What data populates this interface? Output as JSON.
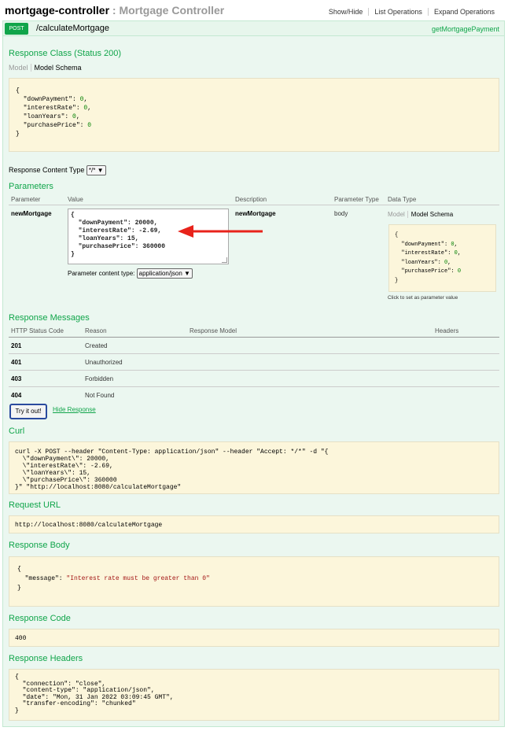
{
  "header": {
    "controller": "mortgage-controller",
    "controller_title": " : Mortgage Controller",
    "links": [
      "Show/Hide",
      "List Operations",
      "Expand Operations"
    ]
  },
  "operation": {
    "method": "POST",
    "path": "/calculateMortgage",
    "nickname": "getMortgagePayment",
    "method_color": "#10a54a"
  },
  "response_class": {
    "title": "Response Class (Status 200)",
    "tab_model": "Model",
    "tab_schema": "Model Schema",
    "schema_lines": [
      "{",
      "  \"downPayment\": 0,",
      "  \"interestRate\": 0,",
      "  \"loanYears\": 0,",
      "  \"purchasePrice\": 0",
      "}"
    ]
  },
  "response_content_type": {
    "label": "Response Content Type",
    "value": "*/*"
  },
  "parameters": {
    "title": "Parameters",
    "headers": [
      "Parameter",
      "Value",
      "Description",
      "Parameter Type",
      "Data Type"
    ],
    "row": {
      "name": "newMortgage",
      "value_lines": [
        "{",
        "  \"downPayment\": 20000,",
        "  \"interestRate\": -2.69,",
        "  \"loanYears\": 15,",
        "  \"purchasePrice\": 360000",
        "}"
      ],
      "description": "newMortgage",
      "param_type": "body",
      "content_type_label": "Parameter content type:",
      "content_type_value": "application/json",
      "data_tab_model": "Model",
      "data_tab_schema": "Model Schema",
      "schema_lines": [
        "{",
        "  \"downPayment\": 0,",
        "  \"interestRate\": 0,",
        "  \"loanYears\": 0,",
        "  \"purchasePrice\": 0",
        "}"
      ],
      "click_hint": "Click to set as parameter value"
    },
    "annotation_arrow_color": "#e8231b"
  },
  "response_messages": {
    "title": "Response Messages",
    "headers": [
      "HTTP Status Code",
      "Reason",
      "Response Model",
      "Headers"
    ],
    "rows": [
      {
        "code": "201",
        "reason": "Created"
      },
      {
        "code": "401",
        "reason": "Unauthorized"
      },
      {
        "code": "403",
        "reason": "Forbidden"
      },
      {
        "code": "404",
        "reason": "Not Found"
      }
    ]
  },
  "actions": {
    "try_label": "Try it out!",
    "hide_label": "Hide Response"
  },
  "curl": {
    "title": "Curl",
    "lines": [
      "curl -X POST --header \"Content-Type: application/json\" --header \"Accept: */*\" -d \"{",
      "  \\\"downPayment\\\": 20000,",
      "  \\\"interestRate\\\": -2.69,",
      "  \\\"loanYears\\\": 15,",
      "  \\\"purchasePrice\\\": 360000",
      "}\" \"http://localhost:8080/calculateMortgage\""
    ]
  },
  "request_url": {
    "title": "Request URL",
    "value": "http://localhost:8080/calculateMortgage"
  },
  "response_body": {
    "title": "Response Body",
    "open": "{",
    "key": "  \"message\": ",
    "message": "\"Interest rate must be greater than 0\"",
    "close": "}"
  },
  "response_code": {
    "title": "Response Code",
    "value": "400"
  },
  "response_headers": {
    "title": "Response Headers",
    "lines": [
      "{",
      "  \"connection\": \"close\",",
      "  \"content-type\": \"application/json\",",
      "  \"date\": \"Mon, 31 Jan 2022 03:09:45 GMT\",",
      "  \"transfer-encoding\": \"chunked\"",
      "}"
    ]
  }
}
